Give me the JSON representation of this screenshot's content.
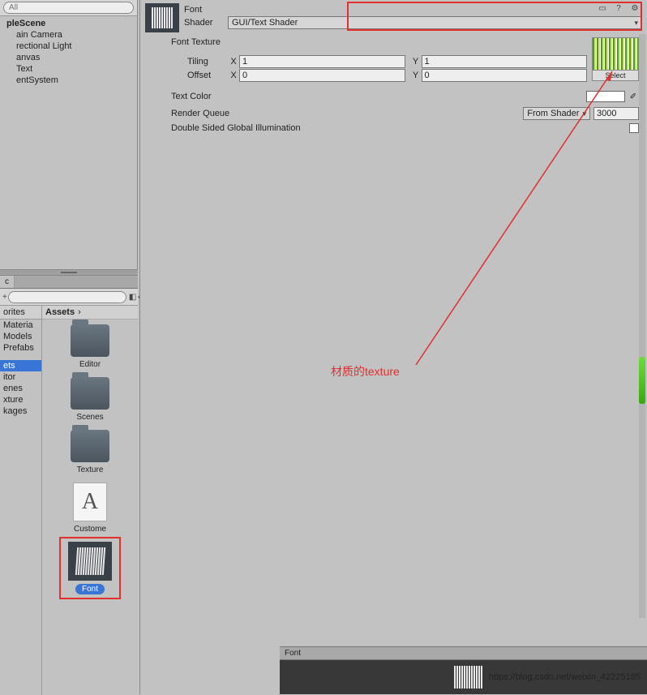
{
  "search_placeholder": "All",
  "scene": {
    "name": "pleScene",
    "items": [
      "ain Camera",
      "rectional Light",
      "anvas",
      "Text",
      "entSystem"
    ]
  },
  "project": {
    "tab": "c",
    "favorites": "orites",
    "fav_items": [
      "Materia",
      "Models",
      "Prefabs"
    ],
    "roots": [
      "ets",
      "itor",
      "enes",
      "xture",
      "kages"
    ],
    "crumb": "Assets",
    "folders": [
      {
        "name": "Editor",
        "type": "folder"
      },
      {
        "name": "Scenes",
        "type": "folder"
      },
      {
        "name": "Texture",
        "type": "folder"
      },
      {
        "name": "Custome",
        "type": "file"
      },
      {
        "name": "Font",
        "type": "material",
        "selected": true
      }
    ]
  },
  "inspector": {
    "title": "Font",
    "shader_label": "Shader",
    "shader_value": "GUI/Text Shader",
    "font_texture": "Font Texture",
    "tiling": "Tiling",
    "offset": "Offset",
    "x": "X",
    "y": "Y",
    "tiling_x": "1",
    "tiling_y": "1",
    "offset_x": "0",
    "offset_y": "0",
    "select": "Select",
    "text_color": "Text Color",
    "render_queue": "Render Queue",
    "rq_mode": "From Shader",
    "rq_value": "3000",
    "dsgi": "Double Sided Global Illumination"
  },
  "annotation": "材质的texture",
  "footer": {
    "path": "Font",
    "url": "https://blog.csdn.net/weixin_42225185"
  }
}
